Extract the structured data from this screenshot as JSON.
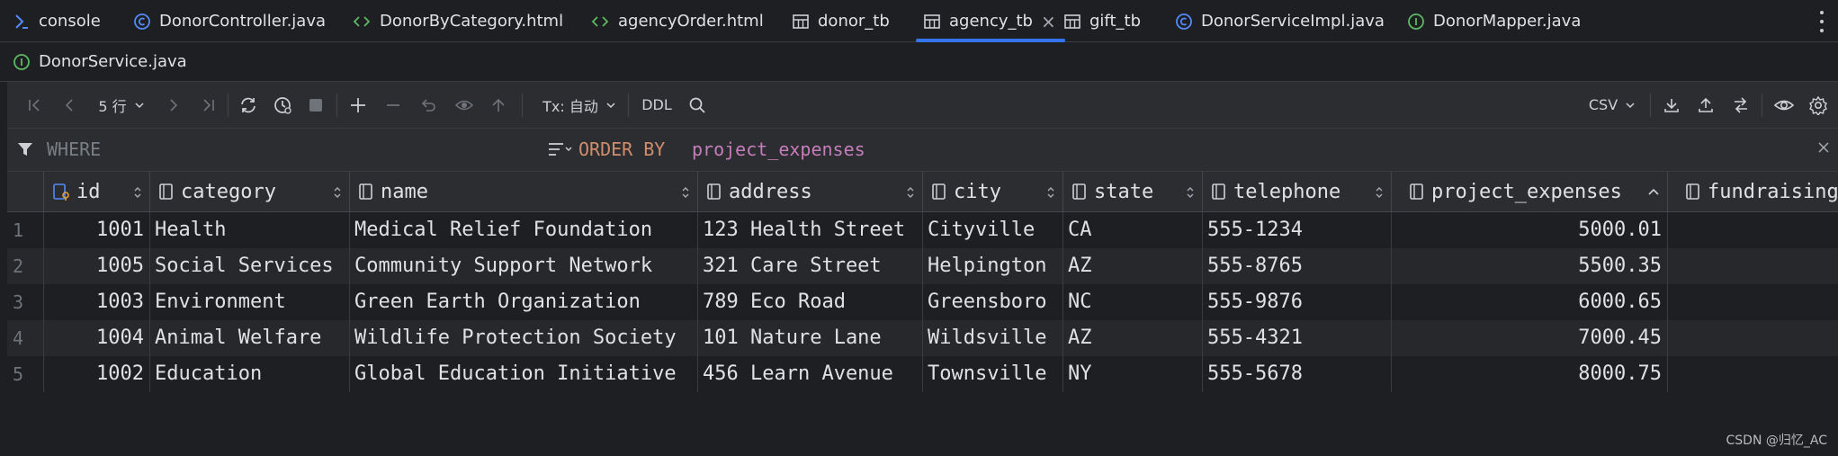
{
  "tabs": [
    {
      "label": "console",
      "icon": "console-icon"
    },
    {
      "label": "DonorController.java",
      "icon": "class-icon"
    },
    {
      "label": "DonorByCategory.html",
      "icon": "html-icon"
    },
    {
      "label": "agencyOrder.html",
      "icon": "html-icon"
    },
    {
      "label": "donor_tb",
      "icon": "table-icon"
    },
    {
      "label": "agency_tb",
      "icon": "table-icon",
      "active": true,
      "close": "×"
    },
    {
      "label": "gift_tb",
      "icon": "table-icon"
    },
    {
      "label": "DonorServiceImpl.java",
      "icon": "class-icon"
    },
    {
      "label": "DonorMapper.java",
      "icon": "interface-icon"
    }
  ],
  "tabs_row2": [
    {
      "label": "DonorService.java",
      "icon": "interface-icon"
    }
  ],
  "toolbar": {
    "rows_label": "5 行",
    "tx_label": "Tx: 自动",
    "ddl_label": "DDL",
    "export_format": "CSV"
  },
  "filter": {
    "where_label": "WHERE",
    "order_by_label": "ORDER BY",
    "order_by_value": "project_expenses"
  },
  "grid": {
    "columns": [
      "id",
      "category",
      "name",
      "address",
      "city",
      "state",
      "telephone",
      "project_expenses",
      "fundraising"
    ],
    "rows": [
      {
        "n": "1",
        "id": "1001",
        "category": "Health",
        "name": "Medical Relief Foundation",
        "address": "123 Health Street",
        "city": "Cityville",
        "state": "CA",
        "telephone": "555-1234",
        "project_expenses": "5000.01"
      },
      {
        "n": "2",
        "id": "1005",
        "category": "Social Services",
        "name": "Community Support Network",
        "address": "321 Care Street",
        "city": "Helpington",
        "state": "AZ",
        "telephone": "555-8765",
        "project_expenses": "5500.35"
      },
      {
        "n": "3",
        "id": "1003",
        "category": "Environment",
        "name": "Green Earth Organization",
        "address": "789 Eco Road",
        "city": "Greensboro",
        "state": "NC",
        "telephone": "555-9876",
        "project_expenses": "6000.65"
      },
      {
        "n": "4",
        "id": "1004",
        "category": "Animal Welfare",
        "name": "Wildlife Protection Society",
        "address": "101 Nature Lane",
        "city": "Wildsville",
        "state": "AZ",
        "telephone": "555-4321",
        "project_expenses": "7000.45"
      },
      {
        "n": "5",
        "id": "1002",
        "category": "Education",
        "name": "Global Education Initiative",
        "address": "456 Learn Avenue",
        "city": "Townsville",
        "state": "NY",
        "telephone": "555-5678",
        "project_expenses": "8000.75"
      }
    ]
  },
  "watermark": "CSDN @归忆_AC",
  "colors": {
    "background": "#1e1f22",
    "panel": "#2b2d30",
    "accent": "#3574f0",
    "keyword": "#cf8e6d",
    "identifier": "#c77dbb"
  }
}
